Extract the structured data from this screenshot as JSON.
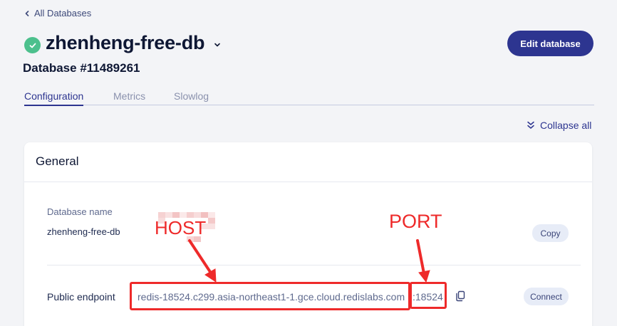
{
  "nav": {
    "back_label": "All Databases"
  },
  "header": {
    "db_name": "zhenheng-free-db",
    "db_id": "Database #11489261",
    "edit_button": "Edit database",
    "status": "active"
  },
  "tabs": [
    {
      "label": "Configuration",
      "active": true
    },
    {
      "label": "Metrics",
      "active": false
    },
    {
      "label": "Slowlog",
      "active": false
    }
  ],
  "toolbar": {
    "collapse_all": "Collapse all"
  },
  "general": {
    "title": "General",
    "database_name_label": "Database name",
    "database_name_value": "zhenheng-free-db",
    "copy_button": "Copy",
    "public_endpoint_label": "Public endpoint",
    "endpoint_host": "redis-18524.c299.asia-northeast1-1.gce.cloud.redislabs.com",
    "endpoint_port": ":18524",
    "connect_button": "Connect"
  },
  "annotations": {
    "host_label": "HOST",
    "port_label": "PORT",
    "color": "#ee2a2a"
  },
  "colors": {
    "primary": "#2d3590",
    "status_green": "#4cc08d",
    "background": "#f3f4f7"
  }
}
